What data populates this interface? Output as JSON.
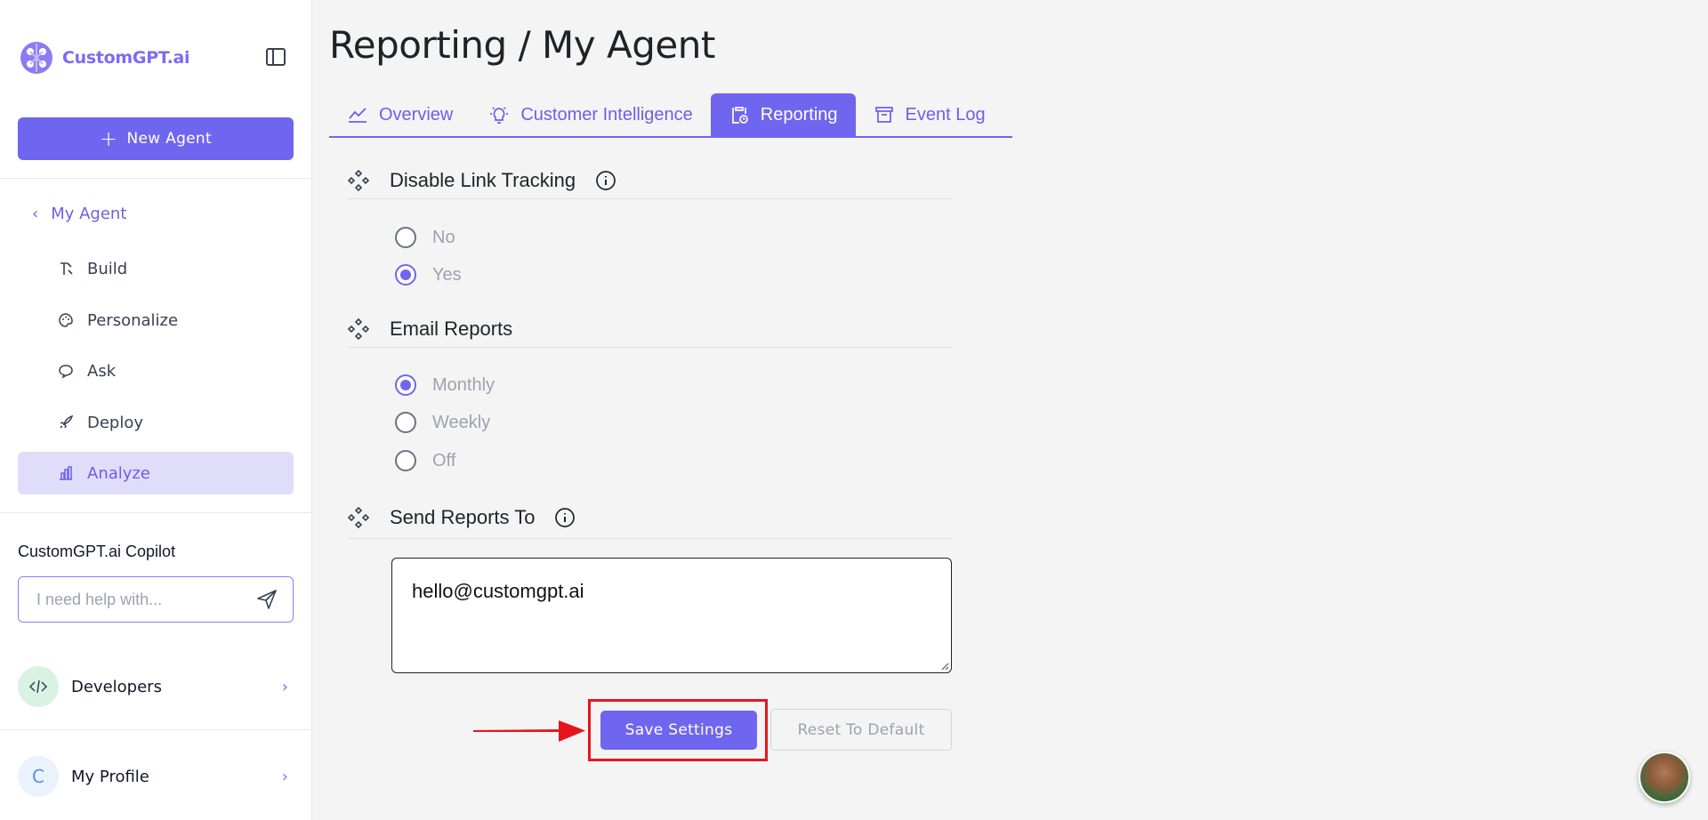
{
  "brand": {
    "name": "CustomGPT.ai",
    "accent": "#7065ee"
  },
  "sidebar": {
    "new_agent_label": "New Agent",
    "back_label": "My Agent",
    "items": [
      {
        "label": "Build",
        "icon": "build-icon"
      },
      {
        "label": "Personalize",
        "icon": "palette-icon"
      },
      {
        "label": "Ask",
        "icon": "chat-icon"
      },
      {
        "label": "Deploy",
        "icon": "rocket-icon"
      },
      {
        "label": "Analyze",
        "icon": "bar-chart-icon",
        "active": true
      }
    ],
    "copilot": {
      "title": "CustomGPT.ai Copilot",
      "placeholder": "I need help with..."
    },
    "developers_label": "Developers",
    "profile": {
      "initial": "C",
      "label": "My Profile"
    }
  },
  "page": {
    "title": "Reporting / My Agent"
  },
  "tabs": [
    {
      "label": "Overview",
      "icon": "line-chart-icon"
    },
    {
      "label": "Customer Intelligence",
      "icon": "lightbulb-icon"
    },
    {
      "label": "Reporting",
      "icon": "clipboard-icon",
      "active": true
    },
    {
      "label": "Event Log",
      "icon": "archive-icon"
    }
  ],
  "sections": {
    "link_tracking": {
      "title": "Disable Link Tracking",
      "options": [
        "No",
        "Yes"
      ],
      "selected": "Yes"
    },
    "email_reports": {
      "title": "Email Reports",
      "options": [
        "Monthly",
        "Weekly",
        "Off"
      ],
      "selected": "Monthly"
    },
    "send_to": {
      "title": "Send Reports To",
      "value": "hello@customgpt.ai"
    }
  },
  "actions": {
    "save_label": "Save Settings",
    "reset_label": "Reset To Default"
  }
}
